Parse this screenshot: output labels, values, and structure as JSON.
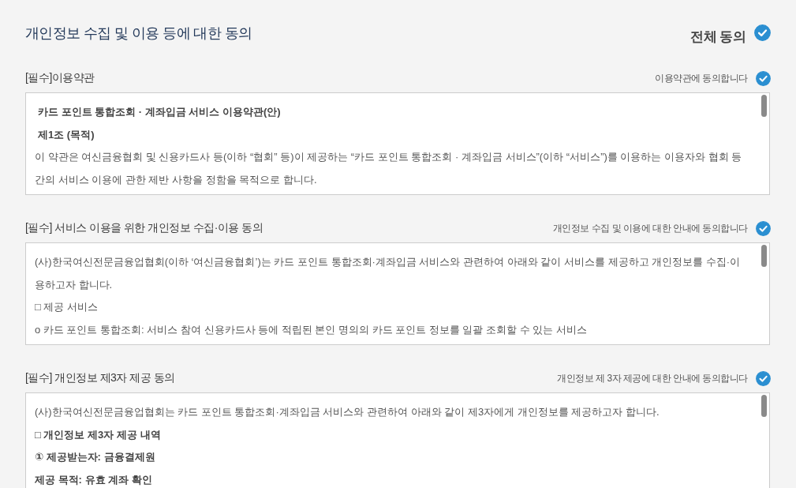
{
  "title": "개인정보 수집 및 이용 등에 대한 동의",
  "agree_all": {
    "label": "전체 동의",
    "checked": true
  },
  "sections": [
    {
      "label": "[필수]이용약관",
      "agree_label": "이용약관에 동의합니다",
      "checked": true,
      "content": [
        {
          "kind": "heading",
          "text": "카드 포인트 통합조회 · 계좌입금 서비스 이용약관(안)"
        },
        {
          "kind": "heading",
          "text": "제1조 (목적)"
        },
        {
          "kind": "text",
          "text": "이 약관은 여신금융협회 및 신용카드사 등(이하 “협회” 등)이 제공하는 “카드 포인트 통합조회 · 계좌입금 서비스”(이하 “서비스”)를 이용하는 이용자와 협회 등 간의 서비스 이용에 관한 제반 사항을 정함을 목적으로 합니다."
        }
      ]
    },
    {
      "label": "[필수] 서비스 이용을 위한 개인정보 수집·이용 동의",
      "agree_label": "개인정보 수집 및 이용에 대한 안내에 동의합니다",
      "checked": true,
      "content": [
        {
          "kind": "text",
          "text": "(사)한국여신전문금융업협회(이하 ‘여신금융협회’)는 카드 포인트 통합조회·계좌입금 서비스와 관련하여 아래와 같이 서비스를 제공하고 개인정보를 수집·이용하고자 합니다."
        },
        {
          "kind": "text",
          "text": "□ 제공 서비스"
        },
        {
          "kind": "text",
          "text": "o 카드 포인트 통합조회: 서비스 참여 신용카드사 등에 적립된 본인 명의의 카드 포인트 정보를 일괄 조회할 수 있는 서비스"
        }
      ]
    },
    {
      "label": "[필수] 개인정보 제3자 제공 동의",
      "agree_label": "개인정보 제 3자 제공에 대한 안내에 동의합니다",
      "checked": true,
      "content": [
        {
          "kind": "text",
          "text": "(사)한국여신전문금융업협회는 카드 포인트 통합조회·계좌입금 서비스와 관련하여 아래와 같이 제3자에게 개인정보를 제공하고자 합니다."
        },
        {
          "kind": "bold",
          "text": "□ 개인정보 제3자 제공 내역"
        },
        {
          "kind": "bold",
          "text": "① 제공받는자: 금융결제원"
        },
        {
          "kind": "bold",
          "text": "제공 목적: 유효 계좌 확인"
        }
      ]
    }
  ]
}
